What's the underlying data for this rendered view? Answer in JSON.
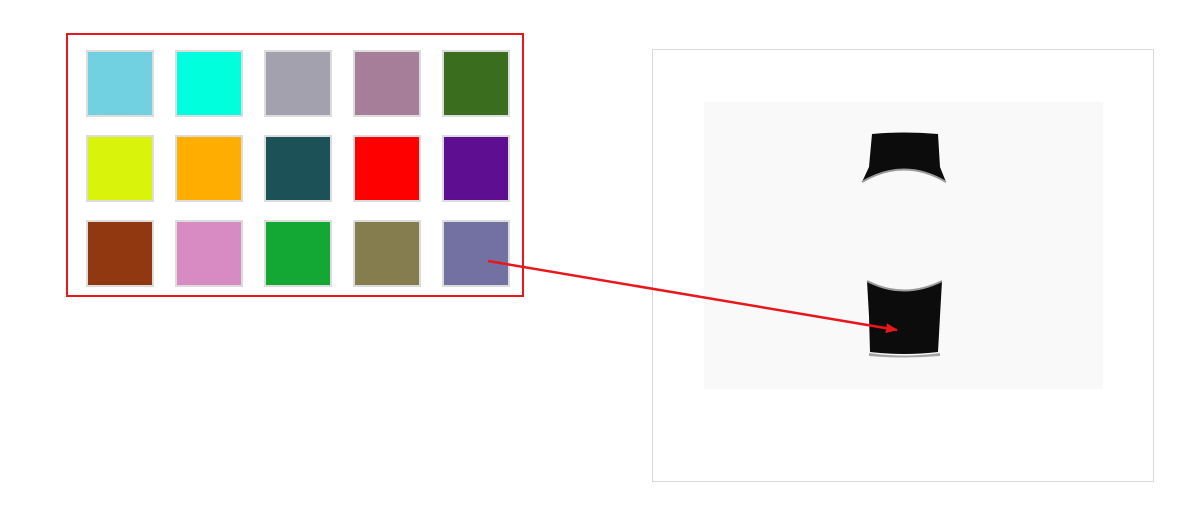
{
  "palette": {
    "swatches": [
      {
        "color": "#72d1e1",
        "name": "light-blue"
      },
      {
        "color": "#00ffdd",
        "name": "cyan"
      },
      {
        "color": "#a2a1ad",
        "name": "gray"
      },
      {
        "color": "#a67e9a",
        "name": "mauve"
      },
      {
        "color": "#3a6e1e",
        "name": "dark-green"
      },
      {
        "color": "#daf30a",
        "name": "lime"
      },
      {
        "color": "#ffae00",
        "name": "orange"
      },
      {
        "color": "#1c5158",
        "name": "dark-teal"
      },
      {
        "color": "#ff0000",
        "name": "red"
      },
      {
        "color": "#5e0e90",
        "name": "purple"
      },
      {
        "color": "#923811",
        "name": "brown"
      },
      {
        "color": "#d88ac3",
        "name": "pink"
      },
      {
        "color": "#13a834",
        "name": "green"
      },
      {
        "color": "#857d4d",
        "name": "olive"
      },
      {
        "color": "#7371a1",
        "name": "slate-blue"
      }
    ],
    "border_color": "#e8171b"
  },
  "preview": {
    "garment_color": "#0c0c0c",
    "garment_name": "watch-strap"
  },
  "arrow": {
    "color": "#e8171b",
    "from": "slate-blue",
    "to": "watch-strap"
  }
}
